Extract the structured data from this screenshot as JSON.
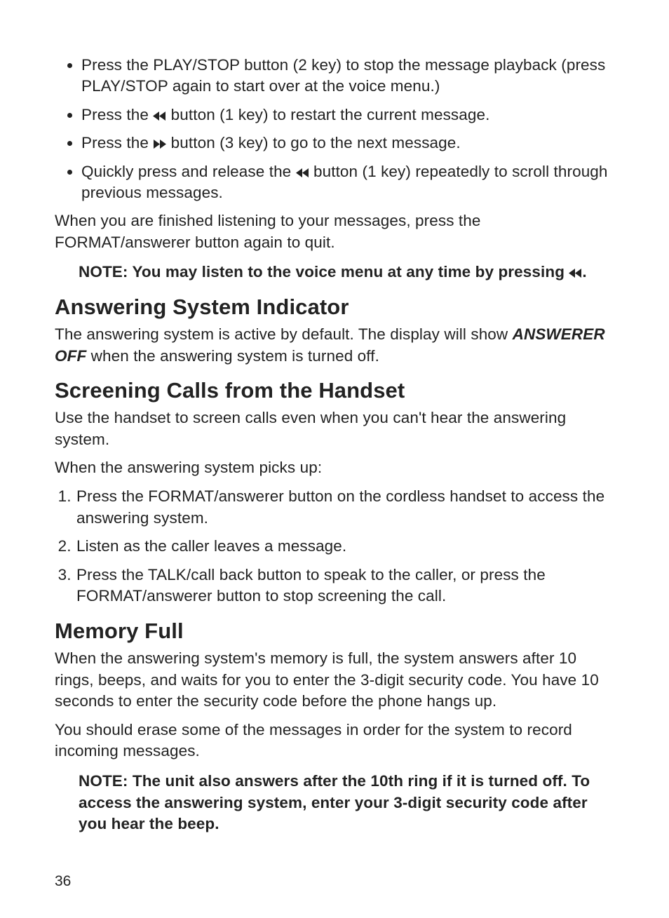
{
  "bullets": {
    "b1": "Press the PLAY/STOP button (2 key) to stop the message playback (press PLAY/STOP again to start over at the voice menu.)",
    "b2a": "Press the ",
    "b2b": " button (1 key) to restart the current message.",
    "b3a": "Press the ",
    "b3b": " button (3 key) to go to the next message.",
    "b4a": "Quickly press and release the ",
    "b4b": " button (1 key) repeatedly to scroll through previous messages."
  },
  "para_finished": "When you are finished listening to your messages, press the FORMAT/answerer button again to quit.",
  "note1a": "NOTE: You may listen to the voice menu at any time by pressing ",
  "note1b": ".",
  "section1": {
    "title": "Answering System Indicator",
    "p1a": "The answering system is active by default. The display will show ",
    "p1_emph": "ANSWERER OFF",
    "p1b": " when the answering system is turned off."
  },
  "section2": {
    "title": "Screening Calls from the Handset",
    "p1": "Use the handset to screen calls even when you can't hear the answering system.",
    "p2": "When the answering system picks up:",
    "steps": {
      "s1": "Press the FORMAT/answerer button on the cordless handset to access the answering system.",
      "s2": "Listen as the caller leaves a message.",
      "s3": "Press the TALK/call back button to speak to the caller, or press the FORMAT/answerer button to stop screening the call."
    }
  },
  "section3": {
    "title": "Memory Full",
    "p1": "When the answering system's memory is full, the system answers after 10 rings, beeps, and waits for you to enter the 3-digit security code. You have 10 seconds to enter the security code before the phone hangs up.",
    "p2": "You should erase some of the messages in order for the system to record incoming messages.",
    "note": "NOTE: The unit also answers after the 10th ring if it is turned off. To access the answering system, enter your 3-digit security code after you hear the beep."
  },
  "page_number": "36"
}
